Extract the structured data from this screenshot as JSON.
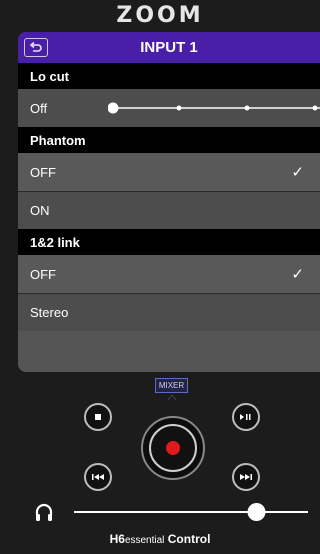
{
  "brand": {
    "logo_text": "ZOOM"
  },
  "header": {
    "title": "INPUT 1",
    "back_icon": "back-arrow-icon",
    "accent": "#4a1fa8"
  },
  "lo_cut": {
    "label": "Lo cut",
    "value": "Off",
    "slider_steps": 4,
    "selected_index": 0
  },
  "phantom": {
    "label": "Phantom",
    "options": [
      "OFF",
      "ON"
    ],
    "selected": "OFF"
  },
  "link": {
    "label": "1&2 link",
    "options": [
      "OFF",
      "Stereo"
    ],
    "selected": "OFF"
  },
  "transport": {
    "mixer_label": "MIXER",
    "record_color": "#e1191f",
    "buttons": [
      "stop-icon",
      "play-pause-icon",
      "previous-icon",
      "next-icon",
      "record-icon"
    ]
  },
  "headphone": {
    "icon": "headphones-icon",
    "volume": 0.78
  },
  "footer": {
    "model": "H6",
    "model_suffix": "essential",
    "app": "Control"
  }
}
